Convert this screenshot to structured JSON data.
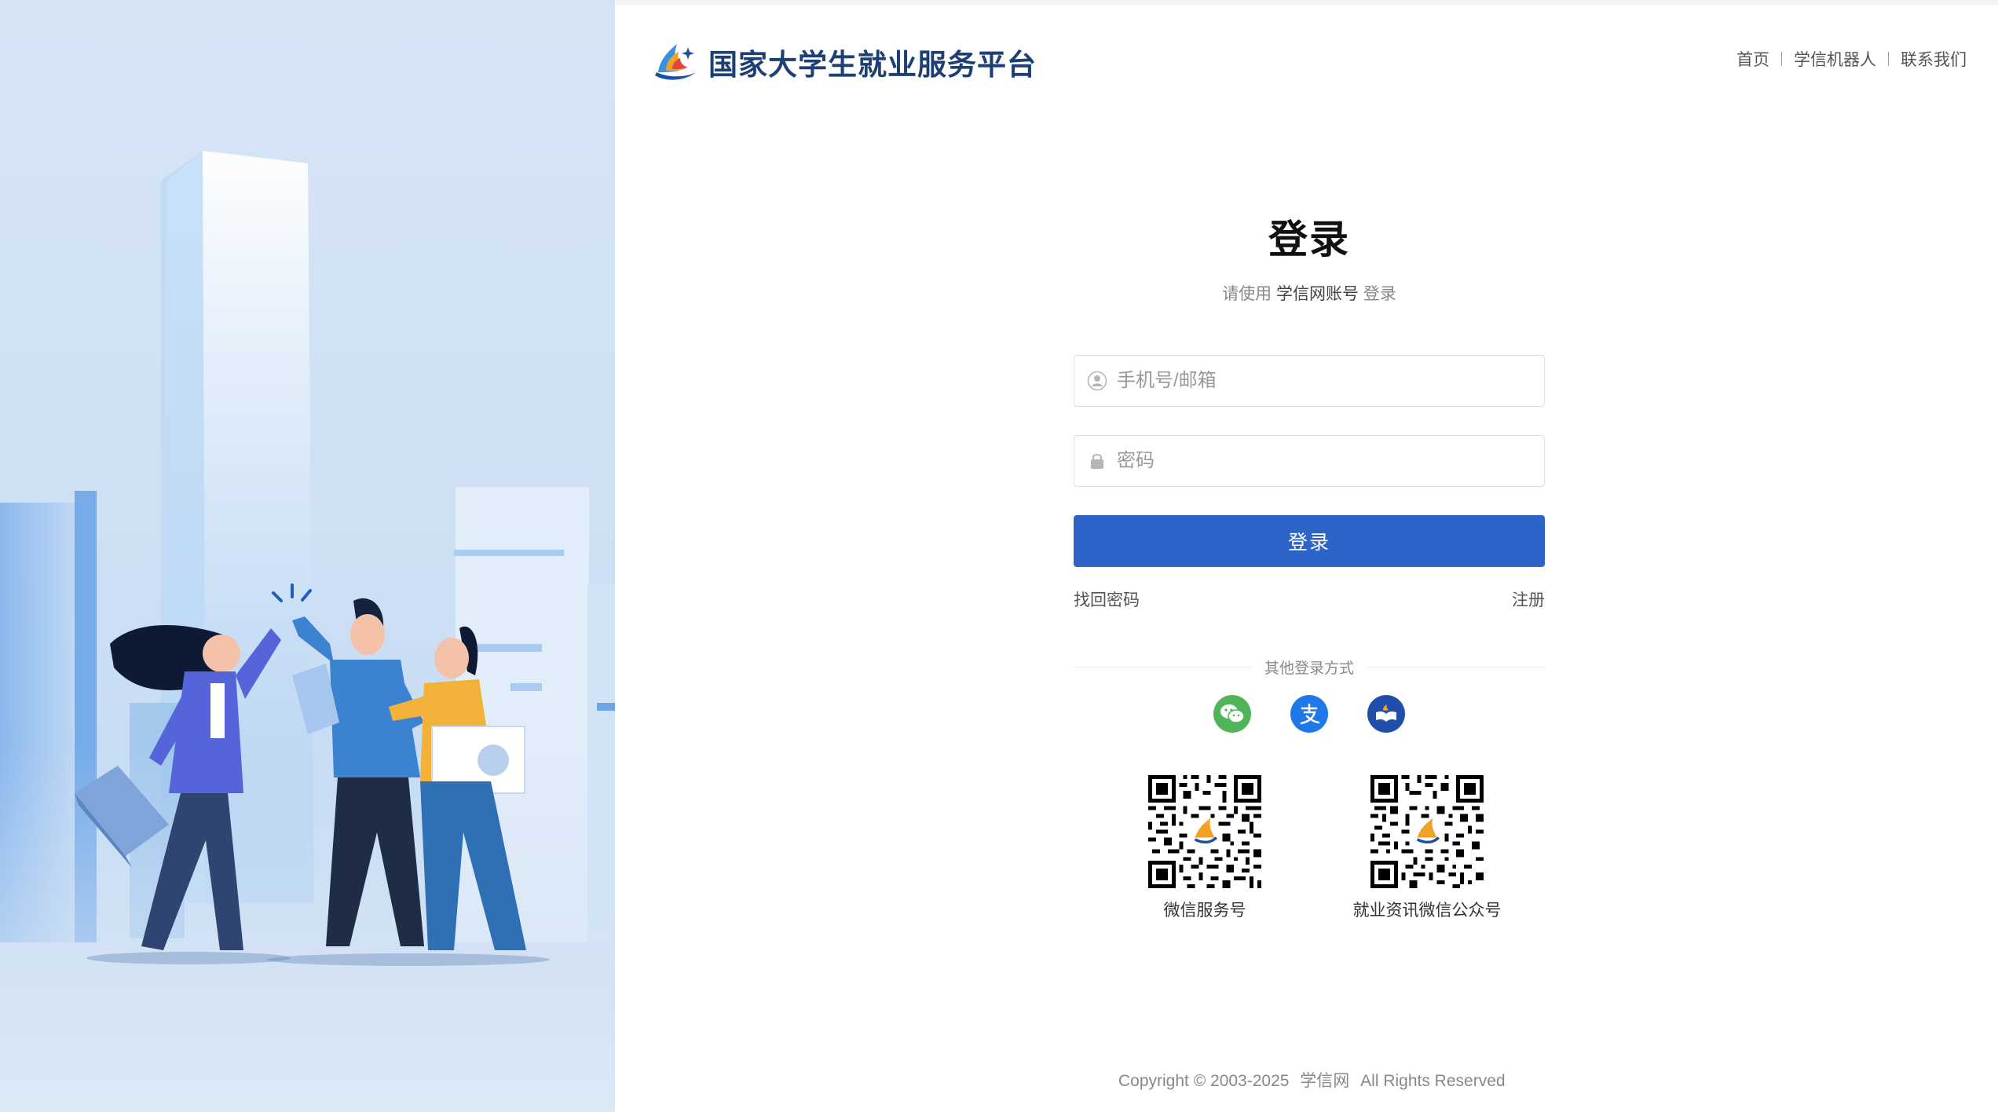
{
  "brand": {
    "title": "国家大学生就业服务平台",
    "logo_icon": "xuexin-flame-logo-icon"
  },
  "nav": {
    "items": [
      {
        "label": "首页"
      },
      {
        "label": "学信机器人"
      },
      {
        "label": "联系我们"
      }
    ]
  },
  "login": {
    "title": "登录",
    "subtitle_prefix": "请使用",
    "subtitle_account": "学信网账号",
    "subtitle_suffix": "登录",
    "username_placeholder": "手机号/邮箱",
    "username_icon": "user-icon",
    "password_placeholder": "密码",
    "password_icon": "lock-icon",
    "submit_label": "登录",
    "forgot_label": "找回密码",
    "register_label": "注册"
  },
  "other_login": {
    "label": "其他登录方式",
    "methods": [
      {
        "icon": "wechat-icon",
        "color": "#4fb558"
      },
      {
        "icon": "alipay-icon",
        "color": "#1e78e8"
      },
      {
        "icon": "xuexin-book-icon",
        "color": "#1f4fa8"
      }
    ]
  },
  "qrcodes": [
    {
      "caption": "微信服务号"
    },
    {
      "caption": "就业资讯微信公众号"
    }
  ],
  "footer": {
    "copyright_text": "Copyright © 2003-2025",
    "site_name": "学信网",
    "rights": "All Rights Reserved"
  },
  "colors": {
    "primary": "#2d64c8",
    "brand_text": "#1d3f73",
    "left_panel_bg": "#d6e5f6"
  }
}
